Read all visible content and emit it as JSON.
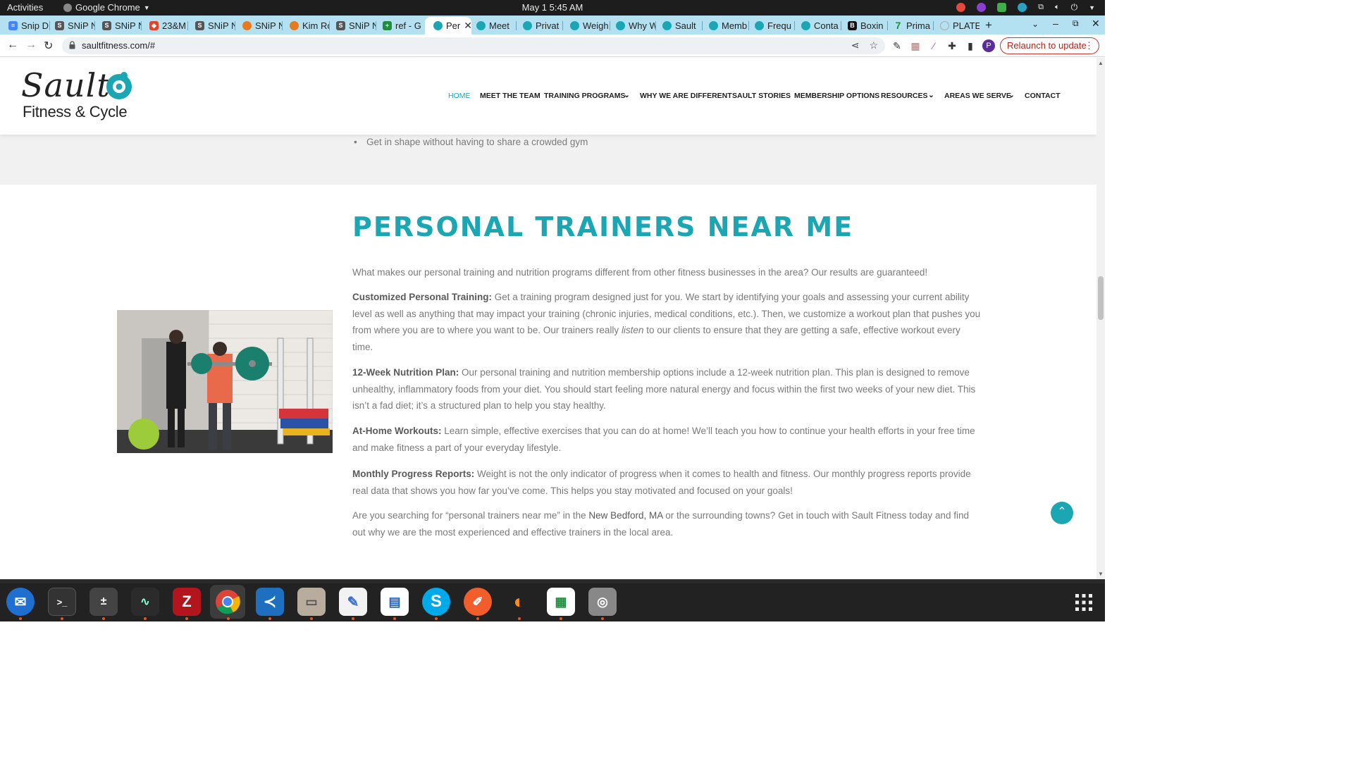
{
  "topbar": {
    "activities": "Activities",
    "app_name": "Google Chrome",
    "clock": "May 1  5:45 AM"
  },
  "tabs": [
    {
      "label": "Snip D"
    },
    {
      "label": "SNiP N"
    },
    {
      "label": "SNiP N"
    },
    {
      "label": "23&M"
    },
    {
      "label": "SNiP N"
    },
    {
      "label": "SNiP N"
    },
    {
      "label": "Kim Ro"
    },
    {
      "label": "SNiP N"
    },
    {
      "label": "ref - G"
    },
    {
      "label": "Per"
    },
    {
      "label": "Meet"
    },
    {
      "label": "Privat"
    },
    {
      "label": "Weigh"
    },
    {
      "label": "Why W"
    },
    {
      "label": "Sault"
    },
    {
      "label": "Memb"
    },
    {
      "label": "Frequ"
    },
    {
      "label": "Conta"
    },
    {
      "label": "Boxin"
    },
    {
      "label": "Prima"
    },
    {
      "label": "PLATE"
    }
  ],
  "addressbar": {
    "url": "saultfitness.com/#",
    "profile_initial": "P",
    "relaunch_label": "Relaunch to update"
  },
  "site": {
    "logo_line1": "Sault",
    "logo_line2": "Fitness & Cycle",
    "nav": [
      {
        "label": "HOME"
      },
      {
        "label": "MEET THE TEAM"
      },
      {
        "label": "TRAINING PROGRAMS"
      },
      {
        "label": "WHY WE ARE DIFFERENT"
      },
      {
        "label": "SAULT STORIES"
      },
      {
        "label": "MEMBERSHIP OPTIONS"
      },
      {
        "label": "RESOURCES"
      },
      {
        "label": "AREAS WE SERVE"
      },
      {
        "label": "CONTACT"
      }
    ],
    "prev_bullet": "Get in shape without having to share a crowded gym",
    "heading": "PERSONAL TRAINERS NEAR ME",
    "intro": "What makes our personal training and nutrition programs different from other fitness businesses in the area? Our results are guaranteed!",
    "p1_title": "Customized Personal Training:",
    "p1_text_a": " Get a training program designed just for you. We start by identifying your goals and assessing your current ability level as well as anything that may impact your training (chronic injuries, medical conditions, etc.). Then, we customize a workout plan that pushes you from where you are to where you want to be. Our trainers really ",
    "p1_em": "listen",
    "p1_text_b": " to our clients to ensure that they are getting a safe, effective workout every time.",
    "p2_title": "12-Week Nutrition Plan:",
    "p2_text": " Our personal training and nutrition membership options include a 12-week nutrition plan. This plan is designed to remove unhealthy, inflammatory foods from your diet. You should start feeling more natural energy and focus within the first two weeks of your new diet. This isn’t a fad diet; it’s a structured plan to help you stay healthy.",
    "p3_title": "At-Home Workouts:",
    "p3_text": " Learn simple, effective exercises that you can do at home! We’ll teach you how to continue your health efforts in your free time and make fitness a part of your everyday lifestyle.",
    "p4_title": "Monthly Progress Reports:",
    "p4_text": " Weight is not the only indicator of progress when it comes to health and fitness. Our monthly progress reports provide real data that shows you how far you’ve come. This helps you stay motivated and focused on your goals!",
    "closing_a": "Are you searching for “personal trainers near me” in the ",
    "closing_link": "New Bedford, MA",
    "closing_b": " or the surrounding towns? Get in touch with Sault Fitness today and find out why we are the most experienced and effective trainers in the local area."
  },
  "colors": {
    "brand_teal": "#1aa6b3",
    "tabstrip": "#b3e1f2",
    "relaunch_red": "#b3261e"
  }
}
